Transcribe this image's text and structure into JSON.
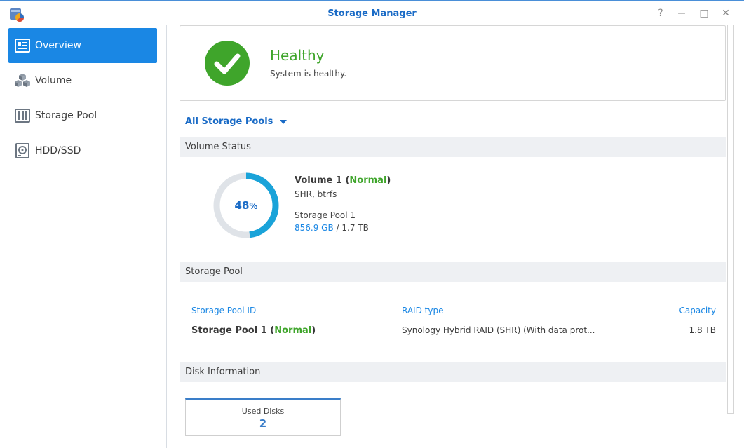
{
  "window": {
    "title": "Storage Manager",
    "help_glyph": "?",
    "minimize_glyph": "—",
    "maximize_glyph": "□",
    "close_glyph": "✕"
  },
  "sidebar": {
    "items": [
      {
        "label": "Overview",
        "icon": "overview-icon",
        "active": true
      },
      {
        "label": "Volume",
        "icon": "volume-cubes-icon",
        "active": false
      },
      {
        "label": "Storage Pool",
        "icon": "storage-pool-icon",
        "active": false
      },
      {
        "label": "HDD/SSD",
        "icon": "hdd-icon",
        "active": false
      }
    ]
  },
  "health": {
    "status": "Healthy",
    "description": "System is healthy."
  },
  "pool_filter": {
    "label": "All Storage Pools"
  },
  "volume_status": {
    "heading": "Volume Status",
    "usage_percent": "48",
    "percent_sign": "%",
    "name": "Volume 1",
    "state": "Normal",
    "fs": "SHR, btrfs",
    "pool": "Storage Pool 1",
    "used": "856.9 GB",
    "total": "1.7 TB"
  },
  "storage_pool": {
    "heading": "Storage Pool",
    "columns": {
      "id": "Storage Pool ID",
      "raid": "RAID type",
      "capacity": "Capacity"
    },
    "rows": [
      {
        "name": "Storage Pool 1",
        "state": "Normal",
        "raid": "Synology Hybrid RAID (SHR) (With data prot...",
        "capacity": "1.8 TB"
      }
    ]
  },
  "disk_info": {
    "heading": "Disk Information",
    "used_label": "Used Disks",
    "used_count": "2"
  },
  "colors": {
    "accent": "#1a87e4",
    "healthy": "#3fa52b",
    "donut_track": "#dfe3e8",
    "donut_fill": "#1aa3d9"
  }
}
